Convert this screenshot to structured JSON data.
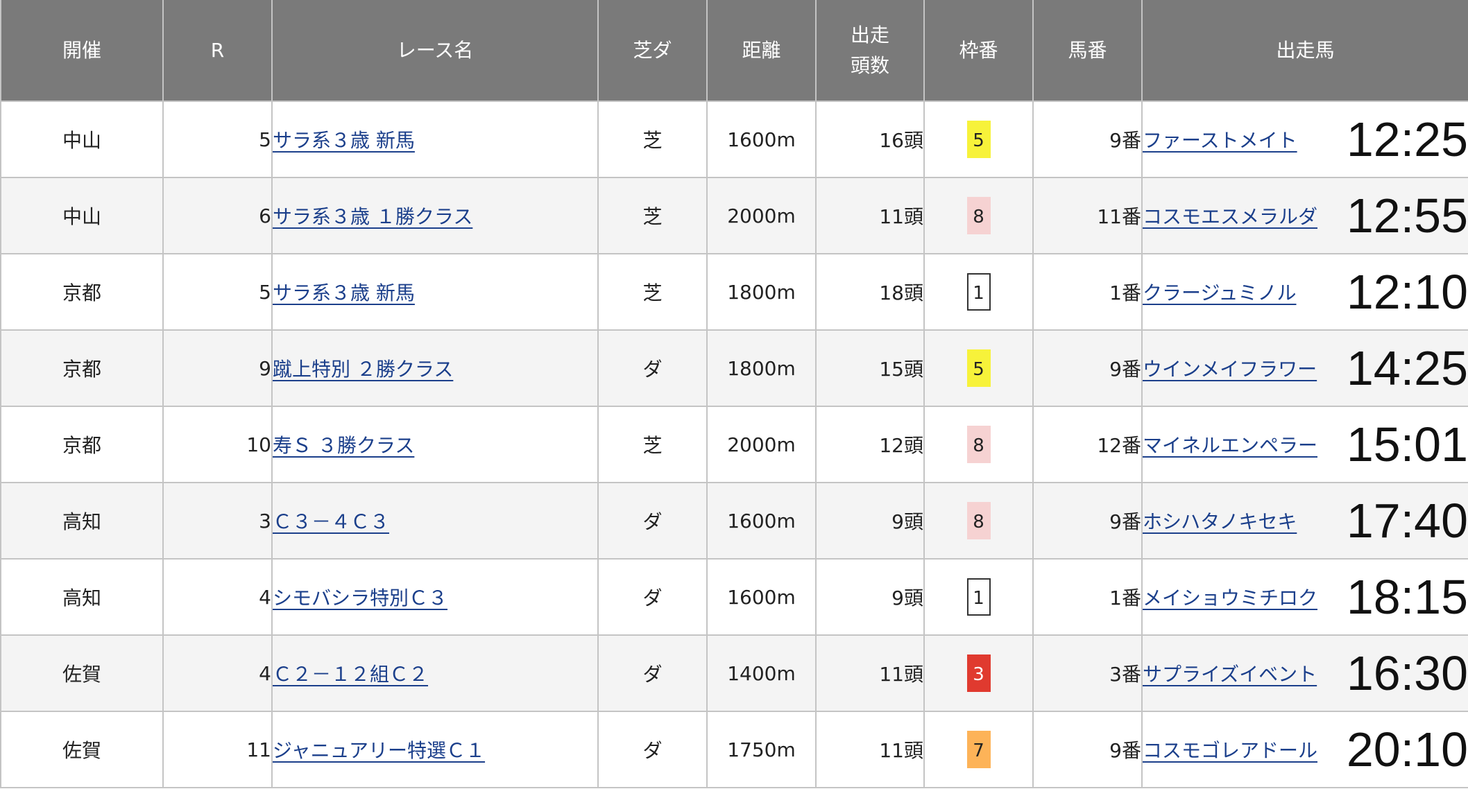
{
  "headers": {
    "venue": "開催",
    "race_no": "R",
    "race_name": "レース名",
    "surface": "芝ダ",
    "distance": "距離",
    "starters": "出走頭数",
    "frame": "枠番",
    "horse_no": "馬番",
    "horse": "出走馬"
  },
  "frame_colors": {
    "1": {
      "bg": "#ffffff",
      "fg": "#222222",
      "border": "#333333"
    },
    "3": {
      "bg": "#e03a2f",
      "fg": "#ffffff",
      "border": "#e03a2f"
    },
    "5": {
      "bg": "#f7f23a",
      "fg": "#222222",
      "border": "#f7f23a"
    },
    "7": {
      "bg": "#fdb358",
      "fg": "#222222",
      "border": "#fdb358"
    },
    "8": {
      "bg": "#f6d2d2",
      "fg": "#222222",
      "border": "#f6d2d2"
    }
  },
  "rows": [
    {
      "venue": "中山",
      "race_no": "5",
      "race_name": "サラ系３歳 新馬",
      "surface": "芝",
      "distance": "1600m",
      "starters": "16頭",
      "frame": "5",
      "horse_no": "9番",
      "horse": "ファーストメイト",
      "time": "12:25"
    },
    {
      "venue": "中山",
      "race_no": "6",
      "race_name": "サラ系３歳 １勝クラス",
      "surface": "芝",
      "distance": "2000m",
      "starters": "11頭",
      "frame": "8",
      "horse_no": "11番",
      "horse": "コスモエスメラルダ",
      "time": "12:55"
    },
    {
      "venue": "京都",
      "race_no": "5",
      "race_name": "サラ系３歳 新馬",
      "surface": "芝",
      "distance": "1800m",
      "starters": "18頭",
      "frame": "1",
      "horse_no": "1番",
      "horse": "クラージュミノル",
      "time": "12:10"
    },
    {
      "venue": "京都",
      "race_no": "9",
      "race_name": "蹴上特別 ２勝クラス",
      "surface": "ダ",
      "distance": "1800m",
      "starters": "15頭",
      "frame": "5",
      "horse_no": "9番",
      "horse": "ウインメイフラワー",
      "time": "14:25"
    },
    {
      "venue": "京都",
      "race_no": "10",
      "race_name": "寿Ｓ ３勝クラス",
      "surface": "芝",
      "distance": "2000m",
      "starters": "12頭",
      "frame": "8",
      "horse_no": "12番",
      "horse": "マイネルエンペラー",
      "time": "15:01"
    },
    {
      "venue": "高知",
      "race_no": "3",
      "race_name": "Ｃ３－４Ｃ３",
      "surface": "ダ",
      "distance": "1600m",
      "starters": "9頭",
      "frame": "8",
      "horse_no": "9番",
      "horse": "ホシハタノキセキ",
      "time": "17:40"
    },
    {
      "venue": "高知",
      "race_no": "4",
      "race_name": "シモバシラ特別Ｃ３",
      "surface": "ダ",
      "distance": "1600m",
      "starters": "9頭",
      "frame": "1",
      "horse_no": "1番",
      "horse": "メイショウミチロク",
      "time": "18:15"
    },
    {
      "venue": "佐賀",
      "race_no": "4",
      "race_name": "Ｃ２－１２組Ｃ２",
      "surface": "ダ",
      "distance": "1400m",
      "starters": "11頭",
      "frame": "3",
      "horse_no": "3番",
      "horse": "サプライズイベント",
      "time": "16:30"
    },
    {
      "venue": "佐賀",
      "race_no": "11",
      "race_name": "ジャニュアリー特選Ｃ１",
      "surface": "ダ",
      "distance": "1750m",
      "starters": "11頭",
      "frame": "7",
      "horse_no": "9番",
      "horse": "コスモゴレアドール",
      "time": "20:10"
    }
  ]
}
